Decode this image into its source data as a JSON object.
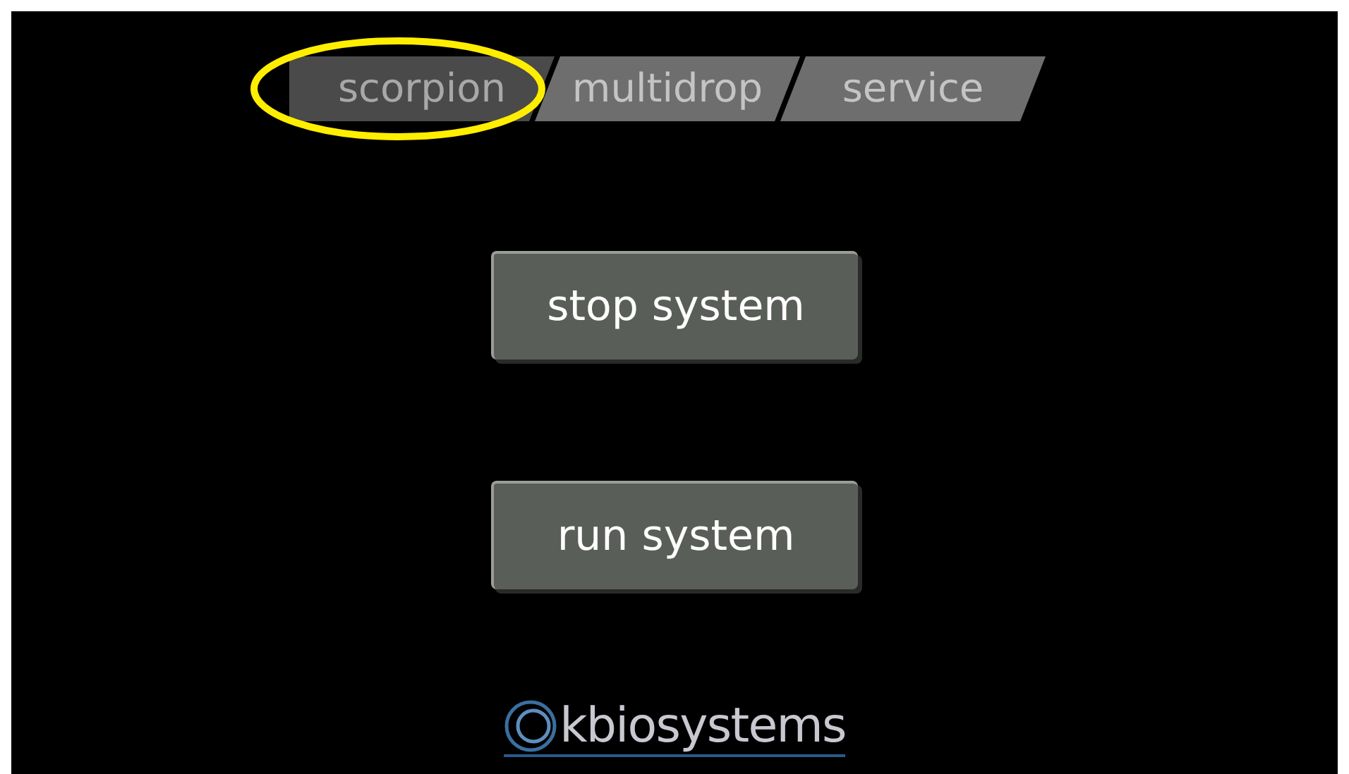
{
  "tabs": [
    {
      "label": "scorpion",
      "selected": true
    },
    {
      "label": "multidrop",
      "selected": false
    },
    {
      "label": "service",
      "selected": false
    }
  ],
  "buttons": [
    "stop system",
    "run system"
  ],
  "logo": {
    "text": "kbiosystems"
  }
}
